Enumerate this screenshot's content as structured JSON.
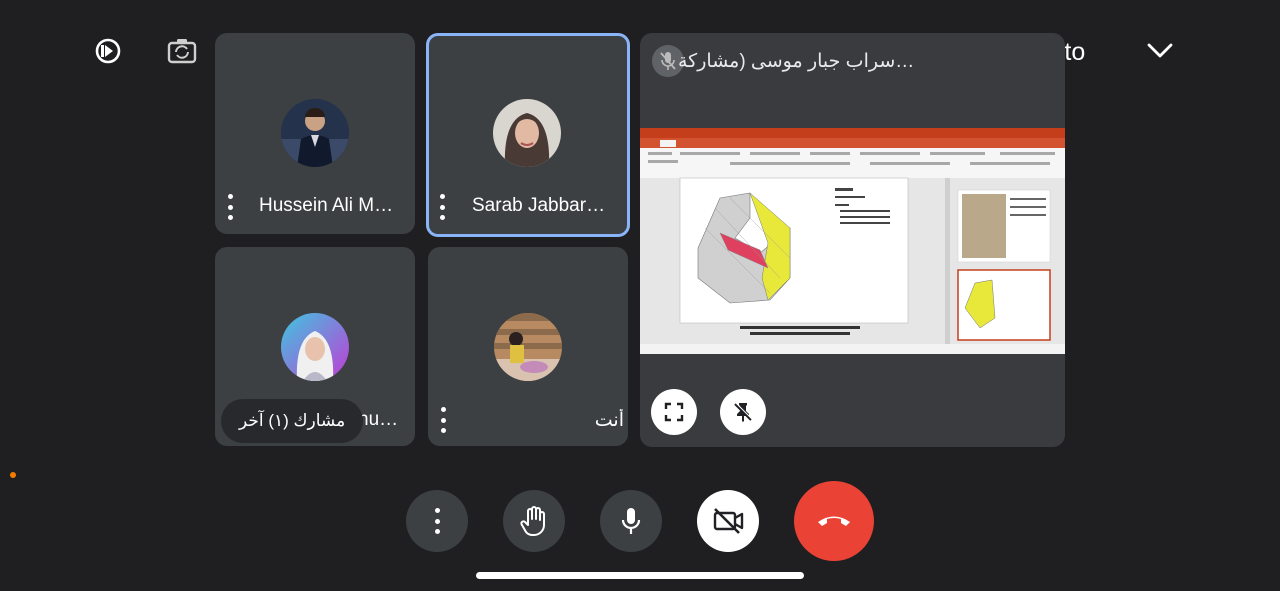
{
  "meeting": {
    "code": "rmb-ucop-yto"
  },
  "participants": [
    {
      "name": "Hussein Ali M…"
    },
    {
      "name": "Sarab Jabbar…"
    },
    {
      "name": "nu…"
    },
    {
      "name": "أنت"
    }
  ],
  "others_pill": "مشارك (١) آخر",
  "presentation": {
    "title": "سراب جبار موسى (مشاركة…  rab Jabbar Musa"
  },
  "colors": {
    "active_outline": "#8ab4f8",
    "end_call": "#ea4335",
    "tile_bg": "#3c4043"
  },
  "icons": {
    "top_left": "audio-output-icon",
    "top_second": "switch-camera-icon",
    "expand": "chevron-down-icon"
  }
}
